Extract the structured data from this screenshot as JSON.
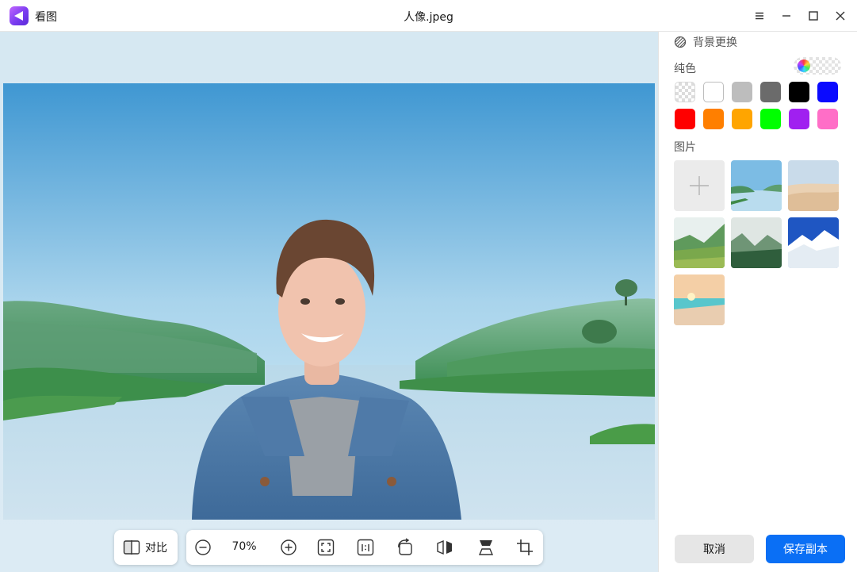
{
  "app": {
    "name": "看图",
    "logo_icon": "app-logo-icon"
  },
  "window": {
    "title": "人像.jpeg",
    "controls": [
      "menu-icon",
      "minimize-icon",
      "maximize-icon",
      "close-icon"
    ]
  },
  "toolbar": {
    "compare_label": "对比",
    "zoom_level": "70%",
    "tools": [
      "zoom-out-icon",
      "zoom-in-icon",
      "fit-window-icon",
      "actual-size-icon",
      "rotate-icon",
      "flip-horizontal-icon",
      "flip-vertical-icon",
      "crop-icon"
    ]
  },
  "panel": {
    "title": "背景更换",
    "solid_label": "纯色",
    "image_label": "图片",
    "colors": [
      "transparent",
      "#ffffff",
      "#bdbdbd",
      "#6b6b6b",
      "#000000",
      "#0a0aff",
      "#ff0000",
      "#ff7f00",
      "#ffa500",
      "#00ff00",
      "#a020f0",
      "#ff6ec7"
    ],
    "image_thumbs": [
      "add-image-icon",
      "lake-hills",
      "desert",
      "green-mountains",
      "forest-fog",
      "snow-mountains",
      "beach-sunset"
    ],
    "cancel_label": "取消",
    "save_label": "保存副本"
  }
}
